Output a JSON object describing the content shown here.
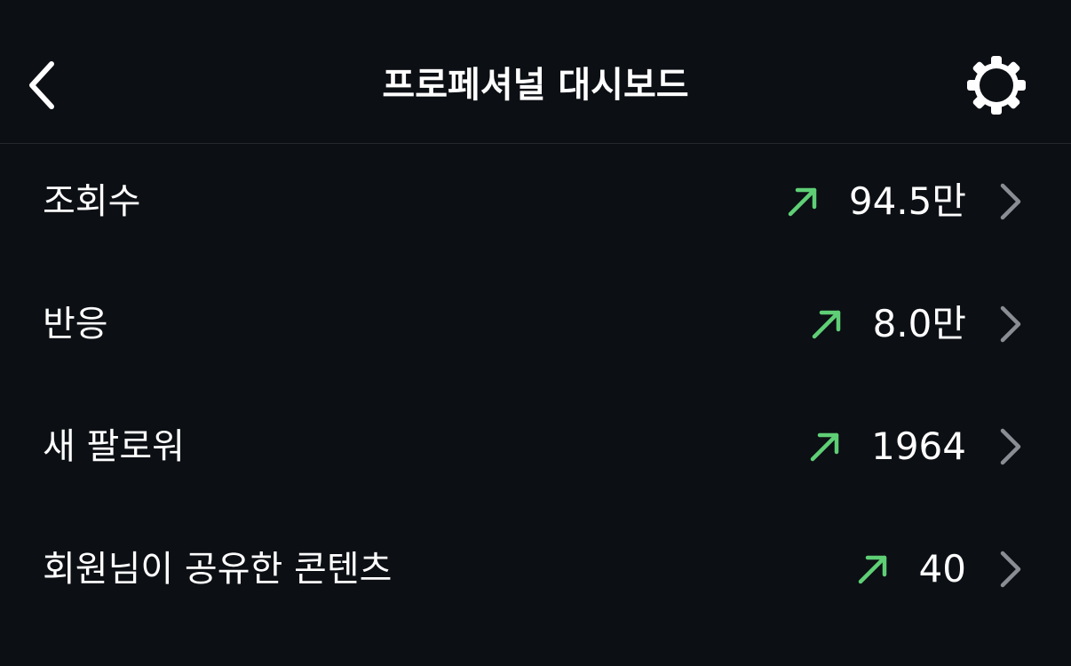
{
  "header": {
    "title": "프로페셔널 대시보드",
    "back_icon": "chevron-left-icon",
    "settings_icon": "gear-icon"
  },
  "colors": {
    "background": "#0c0f14",
    "trend_up": "#5fcf76",
    "chevron": "#8a8d93",
    "divider": "#25282d"
  },
  "metrics": [
    {
      "label": "조회수",
      "value": "94.5만",
      "trend": "up"
    },
    {
      "label": "반응",
      "value": "8.0만",
      "trend": "up"
    },
    {
      "label": "새 팔로워",
      "value": "1964",
      "trend": "up"
    },
    {
      "label": "회원님이 공유한 콘텐츠",
      "value": "40",
      "trend": "up"
    }
  ]
}
